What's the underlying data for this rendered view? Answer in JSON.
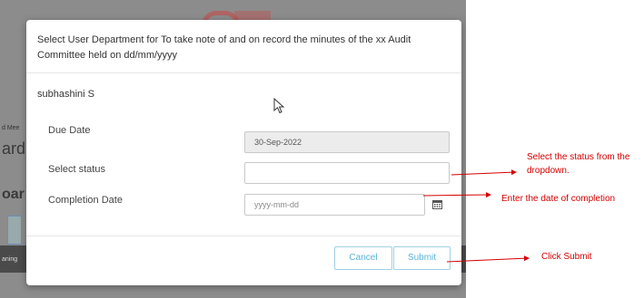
{
  "backdrop": {
    "text1": "d Mee",
    "text2": "ard",
    "text3": "oar",
    "text4": "aning"
  },
  "modal": {
    "title": "Select User Department for To take note of and on record the minutes of the xx Audit Committee held on dd/mm/yyyy",
    "user": "subhashini S",
    "due_date_label": "Due Date",
    "due_date_value": "30-Sep-2022",
    "status_label": "Select status",
    "status_value": "",
    "completion_label": "Completion Date",
    "completion_placeholder": "yyyy-mm-dd",
    "cancel_label": "Cancel",
    "submit_label": "Submit"
  },
  "annotations": {
    "status_note": "Select the status from the dropdown.",
    "date_note": "Enter the date of completion",
    "submit_note": "Click Submit",
    "color": "#d40000"
  },
  "icons": {
    "calendar": "calendar-icon",
    "cursor": "mouse-cursor-icon"
  }
}
